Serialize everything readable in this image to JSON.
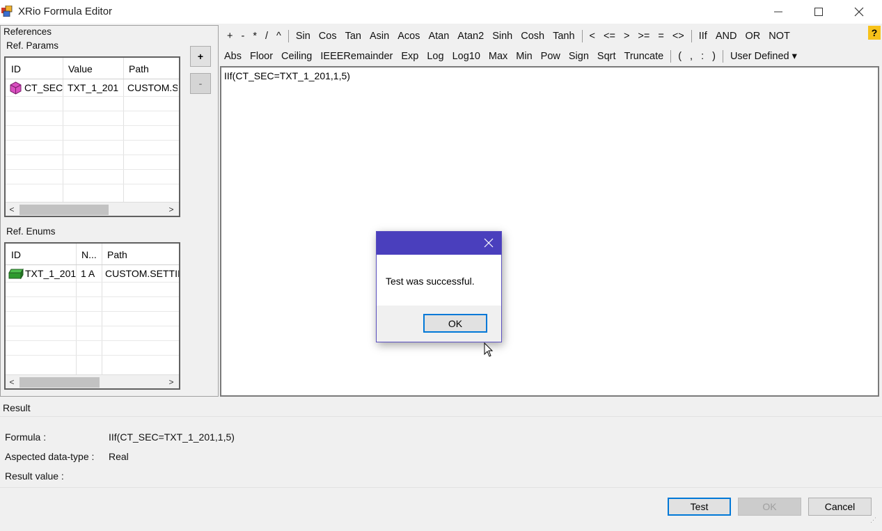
{
  "window": {
    "title": "XRio Formula Editor",
    "minimize_icon": "minimize-icon",
    "maximize_icon": "maximize-icon",
    "close_icon": "close-icon"
  },
  "left_panel": {
    "references_label": "References",
    "ref_params": {
      "caption": "Ref. Params",
      "columns": [
        "ID",
        "Value",
        "Path"
      ],
      "rows": [
        {
          "icon": "cube-magenta-icon",
          "id": "CT_SEC",
          "value": "TXT_1_201",
          "path": "CUSTOM.SI"
        }
      ],
      "add_label": "+",
      "remove_label": "-"
    },
    "ref_enums": {
      "caption": "Ref. Enums",
      "columns": [
        "ID",
        "N...",
        "Path"
      ],
      "rows": [
        {
          "icon": "block-green-icon",
          "id": "TXT_1_201",
          "n": "1 A",
          "path": "CUSTOM.SETTII"
        }
      ]
    },
    "scroll_left": "<",
    "scroll_right": ">"
  },
  "toolbar": {
    "row1": [
      "+",
      "-",
      "*",
      "/",
      "^",
      "|",
      "Sin",
      "Cos",
      "Tan",
      "Asin",
      "Acos",
      "Atan",
      "Atan2",
      "Sinh",
      "Cosh",
      "Tanh",
      "|",
      "<",
      "<=",
      ">",
      ">=",
      "=",
      "<>",
      "|",
      "IIf",
      "AND",
      "OR",
      "NOT"
    ],
    "row2": [
      "Abs",
      "Floor",
      "Ceiling",
      "IEEERemainder",
      "Exp",
      "Log",
      "Log10",
      "Max",
      "Min",
      "Pow",
      "Sign",
      "Sqrt",
      "Truncate",
      "|",
      "(",
      ",",
      ":",
      ")",
      "|",
      "User Defined ▾"
    ],
    "help_label": "?"
  },
  "editor": {
    "formula": "IIf(CT_SEC=TXT_1_201,1,5)"
  },
  "result": {
    "caption": "Result",
    "formula_label": "Formula :",
    "formula_value": "IIf(CT_SEC=TXT_1_201,1,5)",
    "datatype_label": "Aspected data-type :",
    "datatype_value": "Real",
    "result_label": "Result value :",
    "result_value": ""
  },
  "buttons": {
    "test": "Test",
    "ok": "OK",
    "cancel": "Cancel"
  },
  "dialog": {
    "message": "Test was successful.",
    "ok": "OK",
    "close_icon": "close-icon"
  },
  "colors": {
    "dialog_titlebar": "#4a3fbd",
    "focus_blue": "#0078d7",
    "help_yellow": "#f7c21a"
  }
}
